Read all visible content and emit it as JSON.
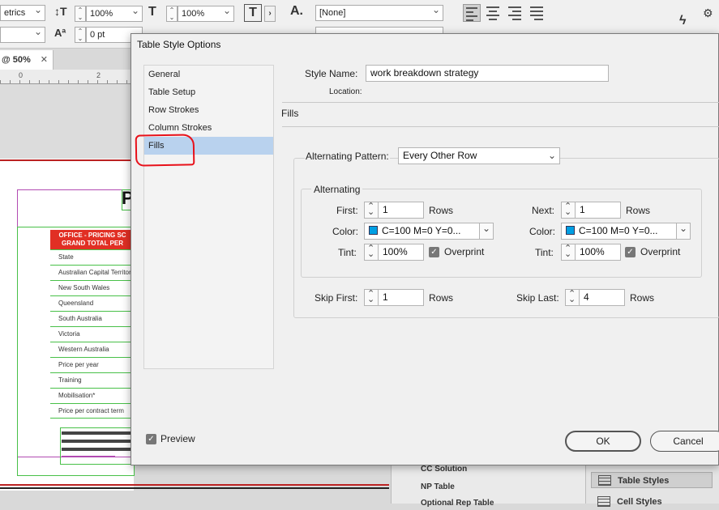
{
  "app": {
    "toolbar": {
      "font_metrics": "etrics",
      "vscale": "100%",
      "hscale": "100%",
      "baseline_shift": "0 pt",
      "char_style": "[None]",
      "lightning_icon": "lightning-icon",
      "gear_icon": "gear-icon"
    },
    "doc_tab": {
      "label": "@ 50%",
      "close": "✕"
    },
    "ruler": {
      "marks": [
        "0",
        "2"
      ]
    },
    "document": {
      "big_letter": "P",
      "table_header_line1": "OFFICE - PRICING SC",
      "table_header_line2": "GRAND TOTAL PER",
      "rows": [
        "State",
        "Australian Capital Territor",
        "New South Wales",
        "Queensland",
        "South Australia",
        "Victoria",
        "Western Australia",
        "Price per year",
        "Training",
        "Mobilisation*",
        "Price per contract term"
      ]
    },
    "bottom_panel": {
      "items": [
        "CC Solution",
        "NP Table",
        "Optional Rep Table"
      ]
    },
    "styles_panel": {
      "items": [
        "Table Styles",
        "Cell Styles"
      ]
    }
  },
  "dialog": {
    "title": "Table Style Options",
    "nav": [
      {
        "label": "General",
        "selected": false
      },
      {
        "label": "Table Setup",
        "selected": false
      },
      {
        "label": "Row Strokes",
        "selected": false
      },
      {
        "label": "Column Strokes",
        "selected": false
      },
      {
        "label": "Fills",
        "selected": true
      }
    ],
    "style_name_label": "Style Name:",
    "style_name_value": "work breakdown strategy",
    "location_label": "Location:",
    "section_title": "Fills",
    "alternating_pattern_label": "Alternating Pattern:",
    "alternating_pattern_value": "Every Other Row",
    "alternating_group_label": "Alternating",
    "first": {
      "label": "First:",
      "value": "1",
      "unit": "Rows"
    },
    "next": {
      "label": "Next:",
      "value": "1",
      "unit": "Rows"
    },
    "color_first": {
      "label": "Color:",
      "value": "C=100 M=0 Y=0...",
      "swatch": "#009fe3"
    },
    "color_next": {
      "label": "Color:",
      "value": "C=100 M=0 Y=0...",
      "swatch": "#009fe3"
    },
    "tint_first": {
      "label": "Tint:",
      "value": "100%",
      "overprint_label": "Overprint",
      "overprint_checked": true
    },
    "tint_next": {
      "label": "Tint:",
      "value": "100%",
      "overprint_label": "Overprint",
      "overprint_checked": true
    },
    "skip_first": {
      "label": "Skip First:",
      "value": "1",
      "unit": "Rows"
    },
    "skip_last": {
      "label": "Skip Last:",
      "value": "4",
      "unit": "Rows"
    },
    "preview": {
      "label": "Preview",
      "checked": true
    },
    "ok_label": "OK",
    "cancel_label": "Cancel",
    "annotation_color": "#e8111a",
    "selection_color": "#b9d2ee"
  }
}
